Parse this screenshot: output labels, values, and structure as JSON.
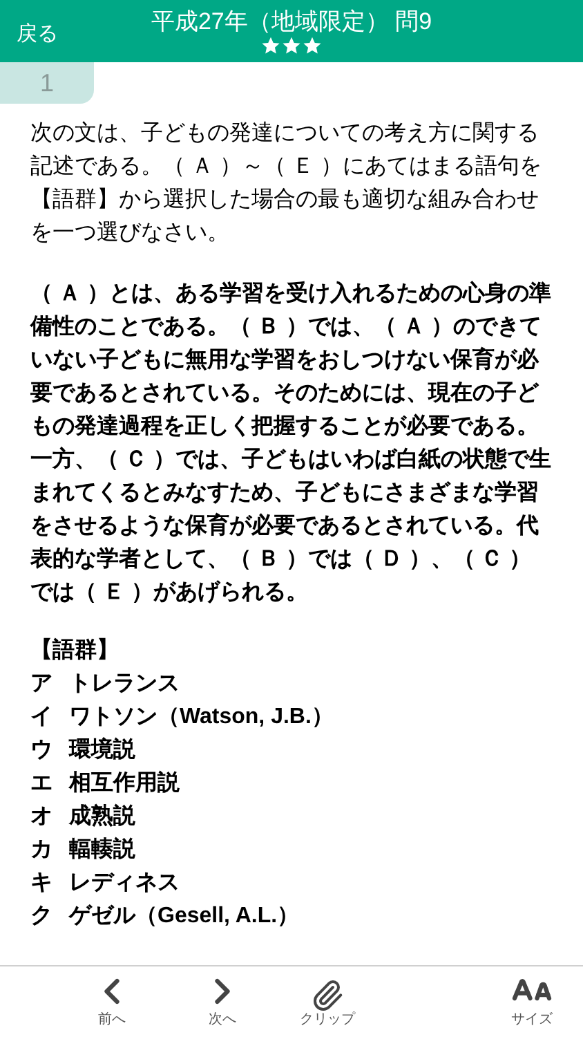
{
  "header": {
    "back": "戻る",
    "title": "平成27年（地域限定） 問9",
    "stars": 3
  },
  "question_tab": "1",
  "intro": "次の文は、子どもの発達についての考え方に関する記述である。（ Ａ ）～（ Ｅ ）にあてはまる語句を【語群】から選択した場合の最も適切な組み合わせを一つ選びなさい。",
  "passage": [
    "（ Ａ ）とは、ある学習を受け入れるための心身の準備性のことである。（ Ｂ ）では、（ Ａ ）のできていない子どもに無用な学習をおしつけない保育が必要であるとされている。そのためには、現在の子どもの発達過程を正しく把握することが必要である。",
    "一方、（ Ｃ ）では、子どもはいわば白紙の状態で生まれてくるとみなすため、子どもにさまざまな学習をさせるような保育が必要であるとされている。代表的な学者として、（ Ｂ ）では（ Ｄ ）、（ Ｃ ）では（ Ｅ ）があげられる。"
  ],
  "word_group": {
    "heading": "【語群】",
    "items": [
      {
        "letter": "ア",
        "term": "トレランス"
      },
      {
        "letter": "イ",
        "term": "ワトソン（Watson, J.B.）"
      },
      {
        "letter": "ウ",
        "term": "環境説"
      },
      {
        "letter": "エ",
        "term": "相互作用説"
      },
      {
        "letter": "オ",
        "term": "成熟説"
      },
      {
        "letter": "カ",
        "term": "輻輳説"
      },
      {
        "letter": "キ",
        "term": "レディネス"
      },
      {
        "letter": "ク",
        "term": "ゲゼル（Gesell, A.L.）"
      }
    ]
  },
  "toolbar": [
    {
      "kind": "prev",
      "label": "前へ"
    },
    {
      "kind": "next",
      "label": "次へ"
    },
    {
      "kind": "clip",
      "label": "クリップ"
    },
    {
      "kind": "size",
      "label": "サイズ"
    }
  ]
}
